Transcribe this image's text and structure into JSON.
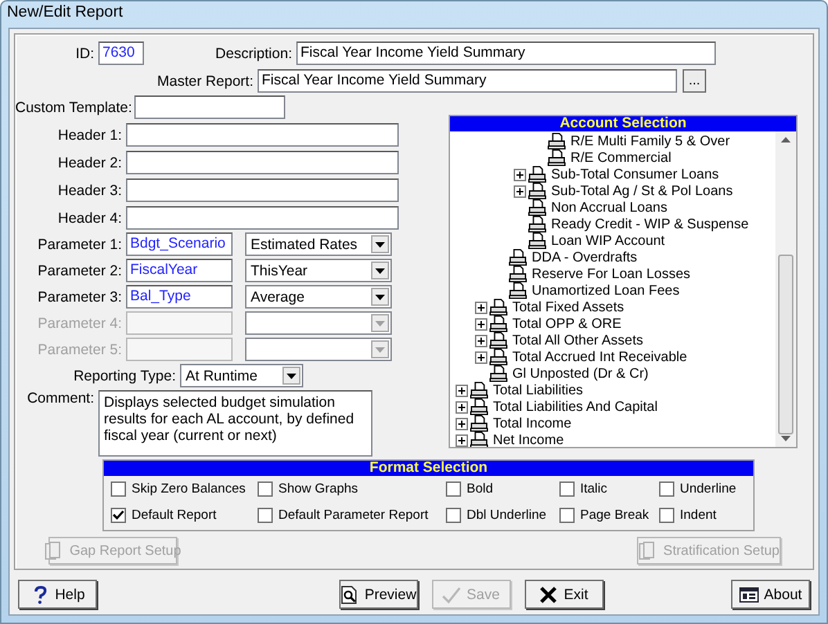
{
  "window": {
    "title": "New/Edit Report"
  },
  "id": {
    "label": "ID:",
    "value": "7630"
  },
  "description": {
    "label": "Description:",
    "value": "Fiscal Year Income Yield Summary"
  },
  "master_report": {
    "label": "Master Report:",
    "value": "Fiscal Year Income Yield Summary",
    "browse_button": "..."
  },
  "custom_template": {
    "label": "Custom Template:"
  },
  "headers": [
    {
      "label": "Header 1:"
    },
    {
      "label": "Header 2:"
    },
    {
      "label": "Header 3:"
    },
    {
      "label": "Header 4:"
    }
  ],
  "parameters": [
    {
      "label": "Parameter 1:",
      "value": "Bdgt_Scenario",
      "option": "Estimated Rates",
      "disabled": false
    },
    {
      "label": "Parameter 2:",
      "value": "FiscalYear",
      "option": "ThisYear",
      "disabled": false
    },
    {
      "label": "Parameter 3:",
      "value": "Bal_Type",
      "option": "Average",
      "disabled": false
    },
    {
      "label": "Parameter 4:",
      "disabled": true
    },
    {
      "label": "Parameter 5:",
      "disabled": true
    }
  ],
  "reporting_type": {
    "label": "Reporting Type:",
    "value": "At Runtime"
  },
  "comment": {
    "label": "Comment:",
    "value": "Displays selected budget simulation results for each AL account, by defined fiscal year (current or next)"
  },
  "account_selection": {
    "title": "Account Selection",
    "items": [
      {
        "children": [
          {
            "children": [
              {
                "children": [
                  {
                    "children": [
                      {
                        "label": "R/E Multi Family 5 & Over",
                        "collapsed": false
                      },
                      {
                        "label": "R/E Commercial",
                        "collapsed": false
                      }
                    ]
                  },
                  {
                    "label": "Sub-Total Consumer Loans",
                    "collapsed": true
                  },
                  {
                    "label": "Sub-Total Ag / St & Pol Loans",
                    "collapsed": true
                  },
                  {
                    "label": "Non Accrual Loans",
                    "collapsed": false
                  },
                  {
                    "label": "Ready Credit - WIP & Suspense",
                    "collapsed": false
                  },
                  {
                    "label": "Loan WIP Account",
                    "collapsed": false
                  }
                ]
              },
              {
                "label": "DDA - Overdrafts",
                "collapsed": false
              },
              {
                "label": "Reserve For Loan Losses",
                "collapsed": false
              },
              {
                "label": "Unamortized Loan Fees",
                "collapsed": false
              }
            ]
          },
          {
            "label": "Total Fixed Assets",
            "collapsed": true
          },
          {
            "label": "Total OPP & ORE",
            "collapsed": true
          },
          {
            "label": "Total All Other Assets",
            "collapsed": true
          },
          {
            "label": "Total Accrued Int Receivable",
            "collapsed": true
          },
          {
            "label": "Gl Unposted (Dr & Cr)",
            "collapsed": false
          }
        ]
      },
      {
        "label": "Total Liabilities",
        "collapsed": true
      },
      {
        "label": "Total Liabilities And Capital",
        "collapsed": true
      },
      {
        "label": "Total Income",
        "collapsed": true
      },
      {
        "label": "Net Income",
        "collapsed": true
      }
    ]
  },
  "format_selection": {
    "title": "Format Selection",
    "options": [
      {
        "label": "Skip Zero Balances",
        "checked": false
      },
      {
        "label": "Show Graphs",
        "checked": false
      },
      {
        "label": "Bold",
        "checked": false
      },
      {
        "label": "Italic",
        "checked": false
      },
      {
        "label": "Underline",
        "checked": false
      },
      {
        "label": "Default Report",
        "checked": true
      },
      {
        "label": "Default Parameter Report",
        "checked": false
      },
      {
        "label": "Dbl Underline",
        "checked": false
      },
      {
        "label": "Page Break",
        "checked": false
      },
      {
        "label": "Indent",
        "checked": false
      }
    ]
  },
  "setup_buttons": [
    {
      "label": "Gap Report Setup",
      "disabled": true
    },
    {
      "label": "Stratification Setup",
      "disabled": true
    }
  ],
  "buttons": [
    {
      "kind": "help",
      "label": "Help",
      "disabled": false
    },
    {
      "kind": "preview",
      "label": "Preview",
      "disabled": false
    },
    {
      "kind": "save",
      "label": "Save",
      "disabled": true
    },
    {
      "kind": "exit",
      "label": "Exit",
      "disabled": false
    },
    {
      "kind": "about",
      "label": "About",
      "disabled": false
    }
  ]
}
